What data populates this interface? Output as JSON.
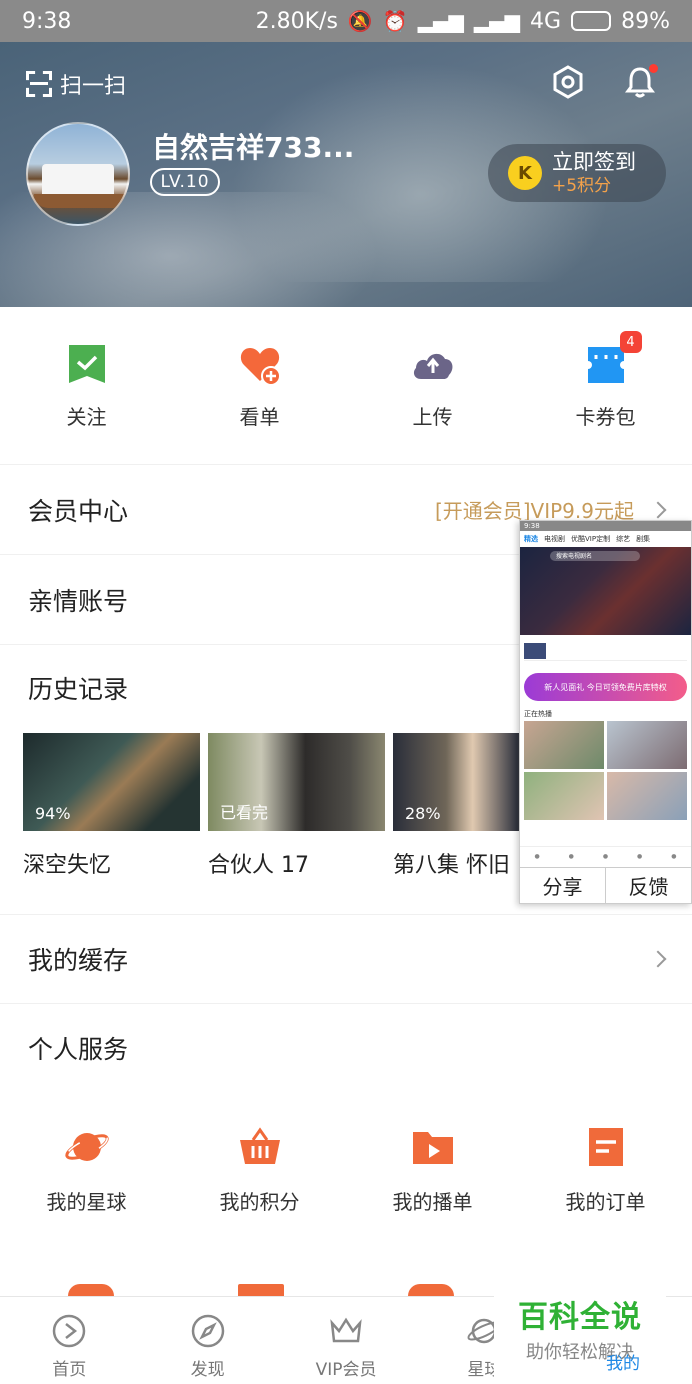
{
  "status_bar": {
    "time": "9:38",
    "speed": "2.80K/s",
    "network": "4G",
    "battery": "89%",
    "battery_level": 0.89
  },
  "header": {
    "scan_label": "扫一扫",
    "username": "自然吉祥733...",
    "level": "LV.10",
    "signin_label": "立即签到",
    "signin_reward": "+5积分",
    "coin_letter": "K"
  },
  "quick_actions": [
    {
      "label": "关注",
      "icon": "bookmark-icon",
      "color": "#4caf50"
    },
    {
      "label": "看单",
      "icon": "heart-plus-icon",
      "color": "#f4683a"
    },
    {
      "label": "上传",
      "icon": "cloud-upload-icon",
      "color": "#6b6588"
    },
    {
      "label": "卡券包",
      "icon": "ticket-icon",
      "color": "#2196f3",
      "badge": "4"
    }
  ],
  "rows": {
    "vip": {
      "title": "会员中心",
      "extra": "[开通会员]VIP9.9元起"
    },
    "family": {
      "title": "亲情账号",
      "extra": "立"
    }
  },
  "history": {
    "title": "历史记录",
    "items": [
      {
        "name": "深空失忆",
        "progress": "94%"
      },
      {
        "name": "合伙人 17",
        "progress": "已看完"
      },
      {
        "name": "第八集 怀旧",
        "progress": "28%"
      }
    ]
  },
  "cache": {
    "title": "我的缓存"
  },
  "services": {
    "title": "个人服务",
    "items": [
      {
        "label": "我的星球",
        "icon": "planet-icon"
      },
      {
        "label": "我的积分",
        "icon": "basket-icon"
      },
      {
        "label": "我的播单",
        "icon": "playlist-icon"
      },
      {
        "label": "我的订单",
        "icon": "order-icon"
      }
    ]
  },
  "floating_preview": {
    "time": "9:38",
    "tabs": [
      "精选",
      "电视剧",
      "优酷VIP定制",
      "综艺",
      "剧集"
    ],
    "search": "搜索电视剧名",
    "hot_label": "正在热播",
    "promo": "新人见面礼 今日可领免费片库特权",
    "share": "分享",
    "feedback": "反馈"
  },
  "tabbar": [
    {
      "label": "首页",
      "icon": "play-circle-icon"
    },
    {
      "label": "发现",
      "icon": "compass-icon"
    },
    {
      "label": "VIP会员",
      "icon": "crown-icon"
    },
    {
      "label": "星球",
      "icon": "planet-outline-icon"
    },
    {
      "label": "我的",
      "icon": "profile-icon"
    }
  ],
  "watermark": {
    "title": "百科全说",
    "subtitle": "助你轻松解决"
  },
  "colors": {
    "accent": "#f4683a",
    "vip_gold": "#c69b5a",
    "brand_blue": "#1e88e5"
  }
}
